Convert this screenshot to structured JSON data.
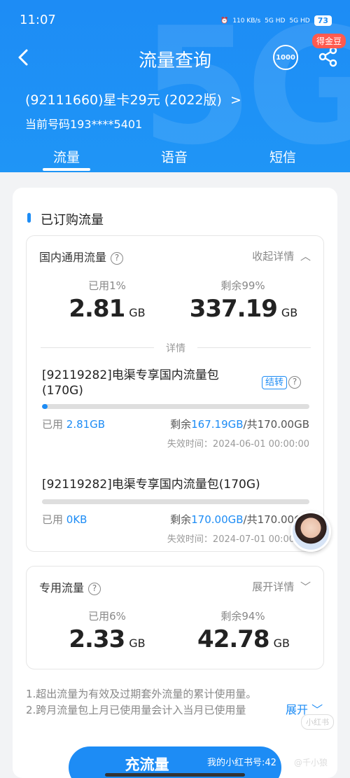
{
  "status": {
    "time": "11:07",
    "net_speed": "110 KB/s",
    "sig1": "5G HD",
    "sig2": "5G HD",
    "battery": "73"
  },
  "nav": {
    "title": "流量查询",
    "service_icon": "1000",
    "badge": "得金豆"
  },
  "account": {
    "plan": "(92111660)星卡29元 (2022版)",
    "plan_arrow": ">",
    "number": "当前号码193****5401"
  },
  "tabs": [
    {
      "label": "流量"
    },
    {
      "label": "语音"
    },
    {
      "label": "短信"
    }
  ],
  "section_title": "已订购流量",
  "domestic": {
    "title": "国内通用流量",
    "help": "?",
    "toggle": "收起详情",
    "used_label": "已用1%",
    "used_value": "2.81",
    "used_unit": "GB",
    "remain_label": "剩余99%",
    "remain_value": "337.19",
    "remain_unit": "GB",
    "detail_label": "详情",
    "packages": [
      {
        "name": "[92119282]电渠专享国内流量包(170G)",
        "tag": "结转",
        "progress": 0.02,
        "used_prefix": "已用 ",
        "used": "2.81GB",
        "remain_prefix": "剩余",
        "remain": "167.19GB",
        "total": "/共170.00GB",
        "expire": "失效时间：2024-06-01 00:00:00"
      },
      {
        "name": "[92119282]电渠专享国内流量包(170G)",
        "progress": 0,
        "used_prefix": "已用 ",
        "used": "0KB",
        "remain_prefix": "剩余",
        "remain": "170.00GB",
        "total": "/共170.00GB",
        "expire": "失效时间：2024-07-01 00:00:00"
      }
    ]
  },
  "special": {
    "title": "专用流量",
    "help": "?",
    "toggle": "展开详情",
    "used_label": "已用6%",
    "used_value": "2.33",
    "used_unit": "GB",
    "remain_label": "剩余94%",
    "remain_value": "42.78",
    "remain_unit": "GB"
  },
  "notes": [
    "1.超出流量为有效及过期套外流量的累计使用量。",
    "2.跨月流量包上月已使用量会计入当月已使用量"
  ],
  "expand": "展开",
  "cta": "充流量",
  "watermark": "我的小红书号:42",
  "watermark2": "@千小狼",
  "watermark3": "小红书",
  "colors": {
    "primary": "#1d8cf5",
    "badge": "#ff5a4f"
  }
}
